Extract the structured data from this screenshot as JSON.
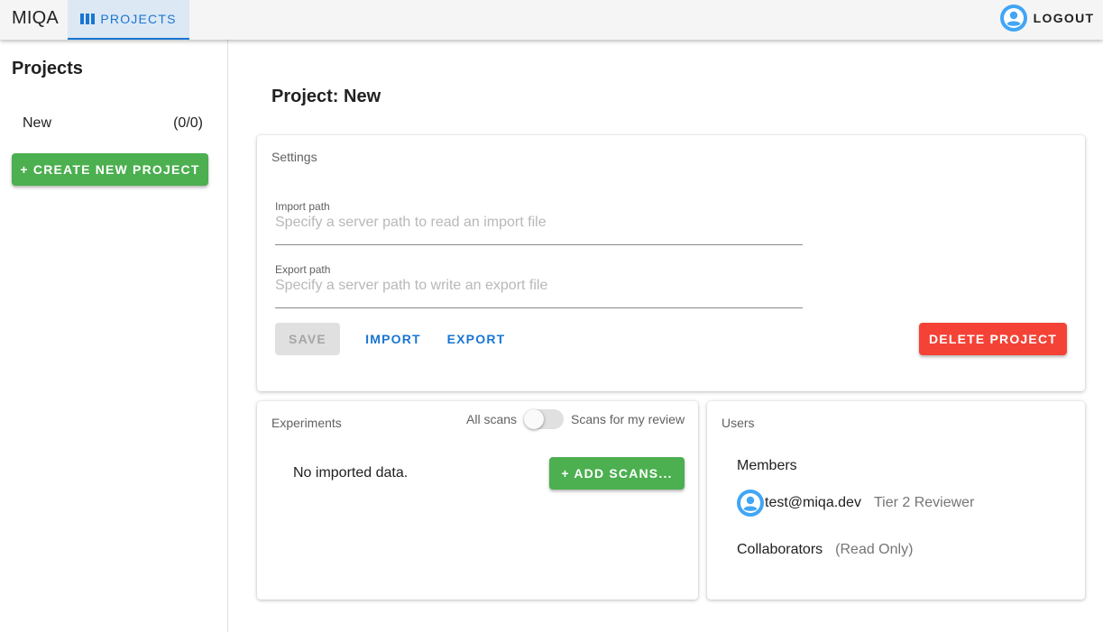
{
  "app": {
    "title": "MIQA"
  },
  "nav": {
    "projects_tab": "PROJECTS",
    "logout": "LOGOUT"
  },
  "sidebar": {
    "heading": "Projects",
    "projects": [
      {
        "name": "New",
        "count": "(0/0)"
      }
    ],
    "create_button": "+ CREATE NEW PROJECT"
  },
  "main": {
    "title": "Project: New",
    "settings": {
      "title": "Settings",
      "import_label": "Import path",
      "import_placeholder": "Specify a server path to read an import file",
      "import_value": "",
      "export_label": "Export path",
      "export_placeholder": "Specify a server path to write an export file",
      "export_value": "",
      "save": "SAVE",
      "import": "IMPORT",
      "export": "EXPORT",
      "delete": "DELETE PROJECT"
    },
    "experiments": {
      "title": "Experiments",
      "toggle_left": "All scans",
      "toggle_right": "Scans for my review",
      "toggle_on": false,
      "empty_text": "No imported data.",
      "add_scans": "+ ADD SCANS..."
    },
    "users": {
      "title": "Users",
      "members_heading": "Members",
      "members": [
        {
          "email": "test@miqa.dev",
          "role": "Tier 2 Reviewer"
        }
      ],
      "collaborators_label": "Collaborators",
      "collaborators_note": "(Read Only)"
    }
  },
  "colors": {
    "primary": "#1976d2",
    "success": "#4caf50",
    "danger": "#f44336",
    "avatar": "#42a5f5"
  },
  "icons": {
    "projects_tab": "view-column-icon",
    "user": "account-circle-icon"
  }
}
